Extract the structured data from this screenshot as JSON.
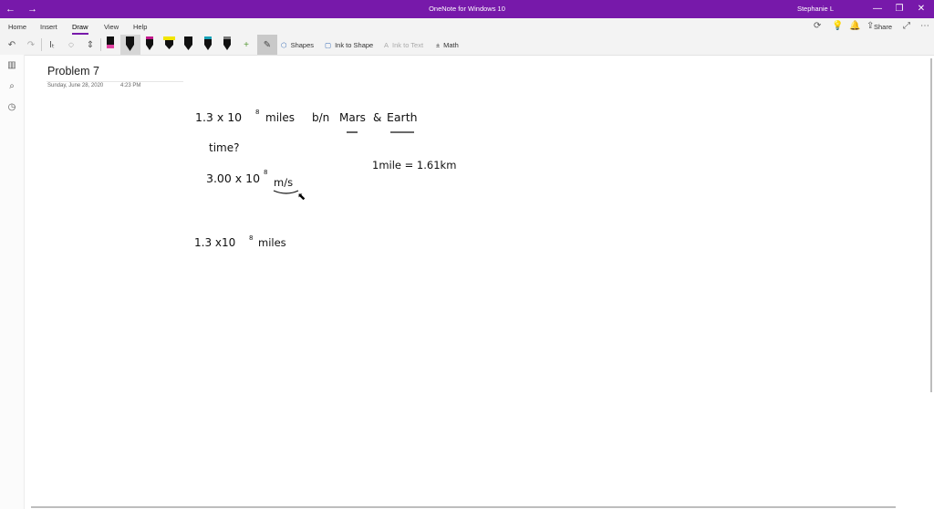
{
  "titlebar": {
    "back_icon": "←",
    "forward_icon": "→",
    "title": "OneNote for Windows 10",
    "user": "Stephanie L",
    "minimize_icon": "—",
    "restore_icon": "❐",
    "close_icon": "✕",
    "color": "#7719aa"
  },
  "menu": {
    "home": "Home",
    "insert": "Insert",
    "draw": "Draw",
    "view": "View",
    "help": "Help",
    "share": "Share"
  },
  "toolbar": {
    "shapes": "Shapes",
    "ink_to_shape": "Ink to Shape",
    "ink_to_text": "Ink to Text",
    "math": "Math",
    "pens": [
      {
        "name": "black-pen-pink-band",
        "color": "#111111",
        "band": "#e040a0"
      },
      {
        "name": "black-pen-selected",
        "color": "#111111",
        "band": "#111111"
      },
      {
        "name": "magenta-pen",
        "color": "#111111",
        "band": "#c0188a"
      },
      {
        "name": "yellow-highlighter",
        "color": "#f2e500",
        "band": "#f2e500"
      },
      {
        "name": "black-pen-2",
        "color": "#111111",
        "band": "#111111"
      },
      {
        "name": "teal-pen",
        "color": "#111111",
        "band": "#17a2b8"
      },
      {
        "name": "gray-pen",
        "color": "#111111",
        "band": "#555555"
      }
    ]
  },
  "page": {
    "title": "Problem 7",
    "date": "Sunday, June 28, 2020",
    "time": "4:23 PM"
  },
  "ink": {
    "line1_num": "1.3 x 10",
    "line1_exp": "8",
    "line1_miles": "miles",
    "line1_btw": "b/n",
    "line1_mars": "Mars",
    "line1_amp": "&",
    "line1_earth": "Earth",
    "line2": "time?",
    "line3_num": "3.00 x 10",
    "line3_exp": "8",
    "line3_unit": "m/s",
    "conv": "1mile  = 1.61km",
    "line4_num": "1.3 x10",
    "line4_exp": "8",
    "line4_miles": "miles"
  }
}
